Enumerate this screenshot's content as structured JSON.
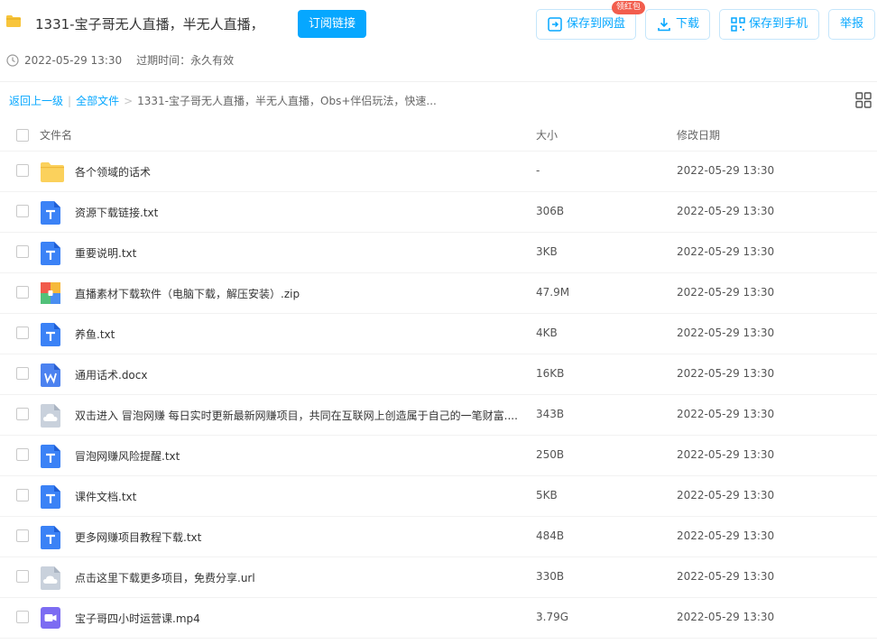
{
  "header": {
    "title": "1331-宝子哥无人直播，半无人直播，...",
    "subscribe_label": "订阅链接",
    "save_cloud_label": "保存到网盘",
    "badge_label": "领红包",
    "download_label": "下载",
    "save_phone_label": "保存到手机",
    "report_label": "举报",
    "time": "2022-05-29 13:30",
    "expire": "过期时间：永久有效",
    "accent_color": "#06a7ff"
  },
  "breadcrumb": {
    "back": "返回上一级",
    "all": "全部文件",
    "current": "1331-宝子哥无人直播，半无人直播，Obs+伴侣玩法，快速..."
  },
  "columns": {
    "name": "文件名",
    "size": "大小",
    "date": "修改日期"
  },
  "files": [
    {
      "name": "各个领域的话术",
      "size": "-",
      "date": "2022-05-29 13:30",
      "icon": "folder-icon"
    },
    {
      "name": "资源下载链接.txt",
      "size": "306B",
      "date": "2022-05-29 13:30",
      "icon": "txt-file-icon"
    },
    {
      "name": "重要说明.txt",
      "size": "3KB",
      "date": "2022-05-29 13:30",
      "icon": "txt-file-icon"
    },
    {
      "name": "直播素材下载软件（电脑下载，解压安装）.zip",
      "size": "47.9M",
      "date": "2022-05-29 13:30",
      "icon": "zip-file-icon"
    },
    {
      "name": "养鱼.txt",
      "size": "4KB",
      "date": "2022-05-29 13:30",
      "icon": "txt-file-icon"
    },
    {
      "name": "通用话术.docx",
      "size": "16KB",
      "date": "2022-05-29 13:30",
      "icon": "word-file-icon"
    },
    {
      "name": "双击进入 冒泡网赚 每日实时更新最新网赚项目，共同在互联网上创造属于自己的一笔财富....",
      "size": "343B",
      "date": "2022-05-29 13:30",
      "icon": "url-file-icon"
    },
    {
      "name": "冒泡网赚风险提醒.txt",
      "size": "250B",
      "date": "2022-05-29 13:30",
      "icon": "txt-file-icon"
    },
    {
      "name": "课件文档.txt",
      "size": "5KB",
      "date": "2022-05-29 13:30",
      "icon": "txt-file-icon"
    },
    {
      "name": "更多网赚项目教程下载.txt",
      "size": "484B",
      "date": "2022-05-29 13:30",
      "icon": "txt-file-icon"
    },
    {
      "name": "点击这里下载更多项目，免费分享.url",
      "size": "330B",
      "date": "2022-05-29 13:30",
      "icon": "url-file-icon"
    },
    {
      "name": "宝子哥四小时运营课.mp4",
      "size": "3.79G",
      "date": "2022-05-29 13:30",
      "icon": "video-file-icon"
    }
  ]
}
